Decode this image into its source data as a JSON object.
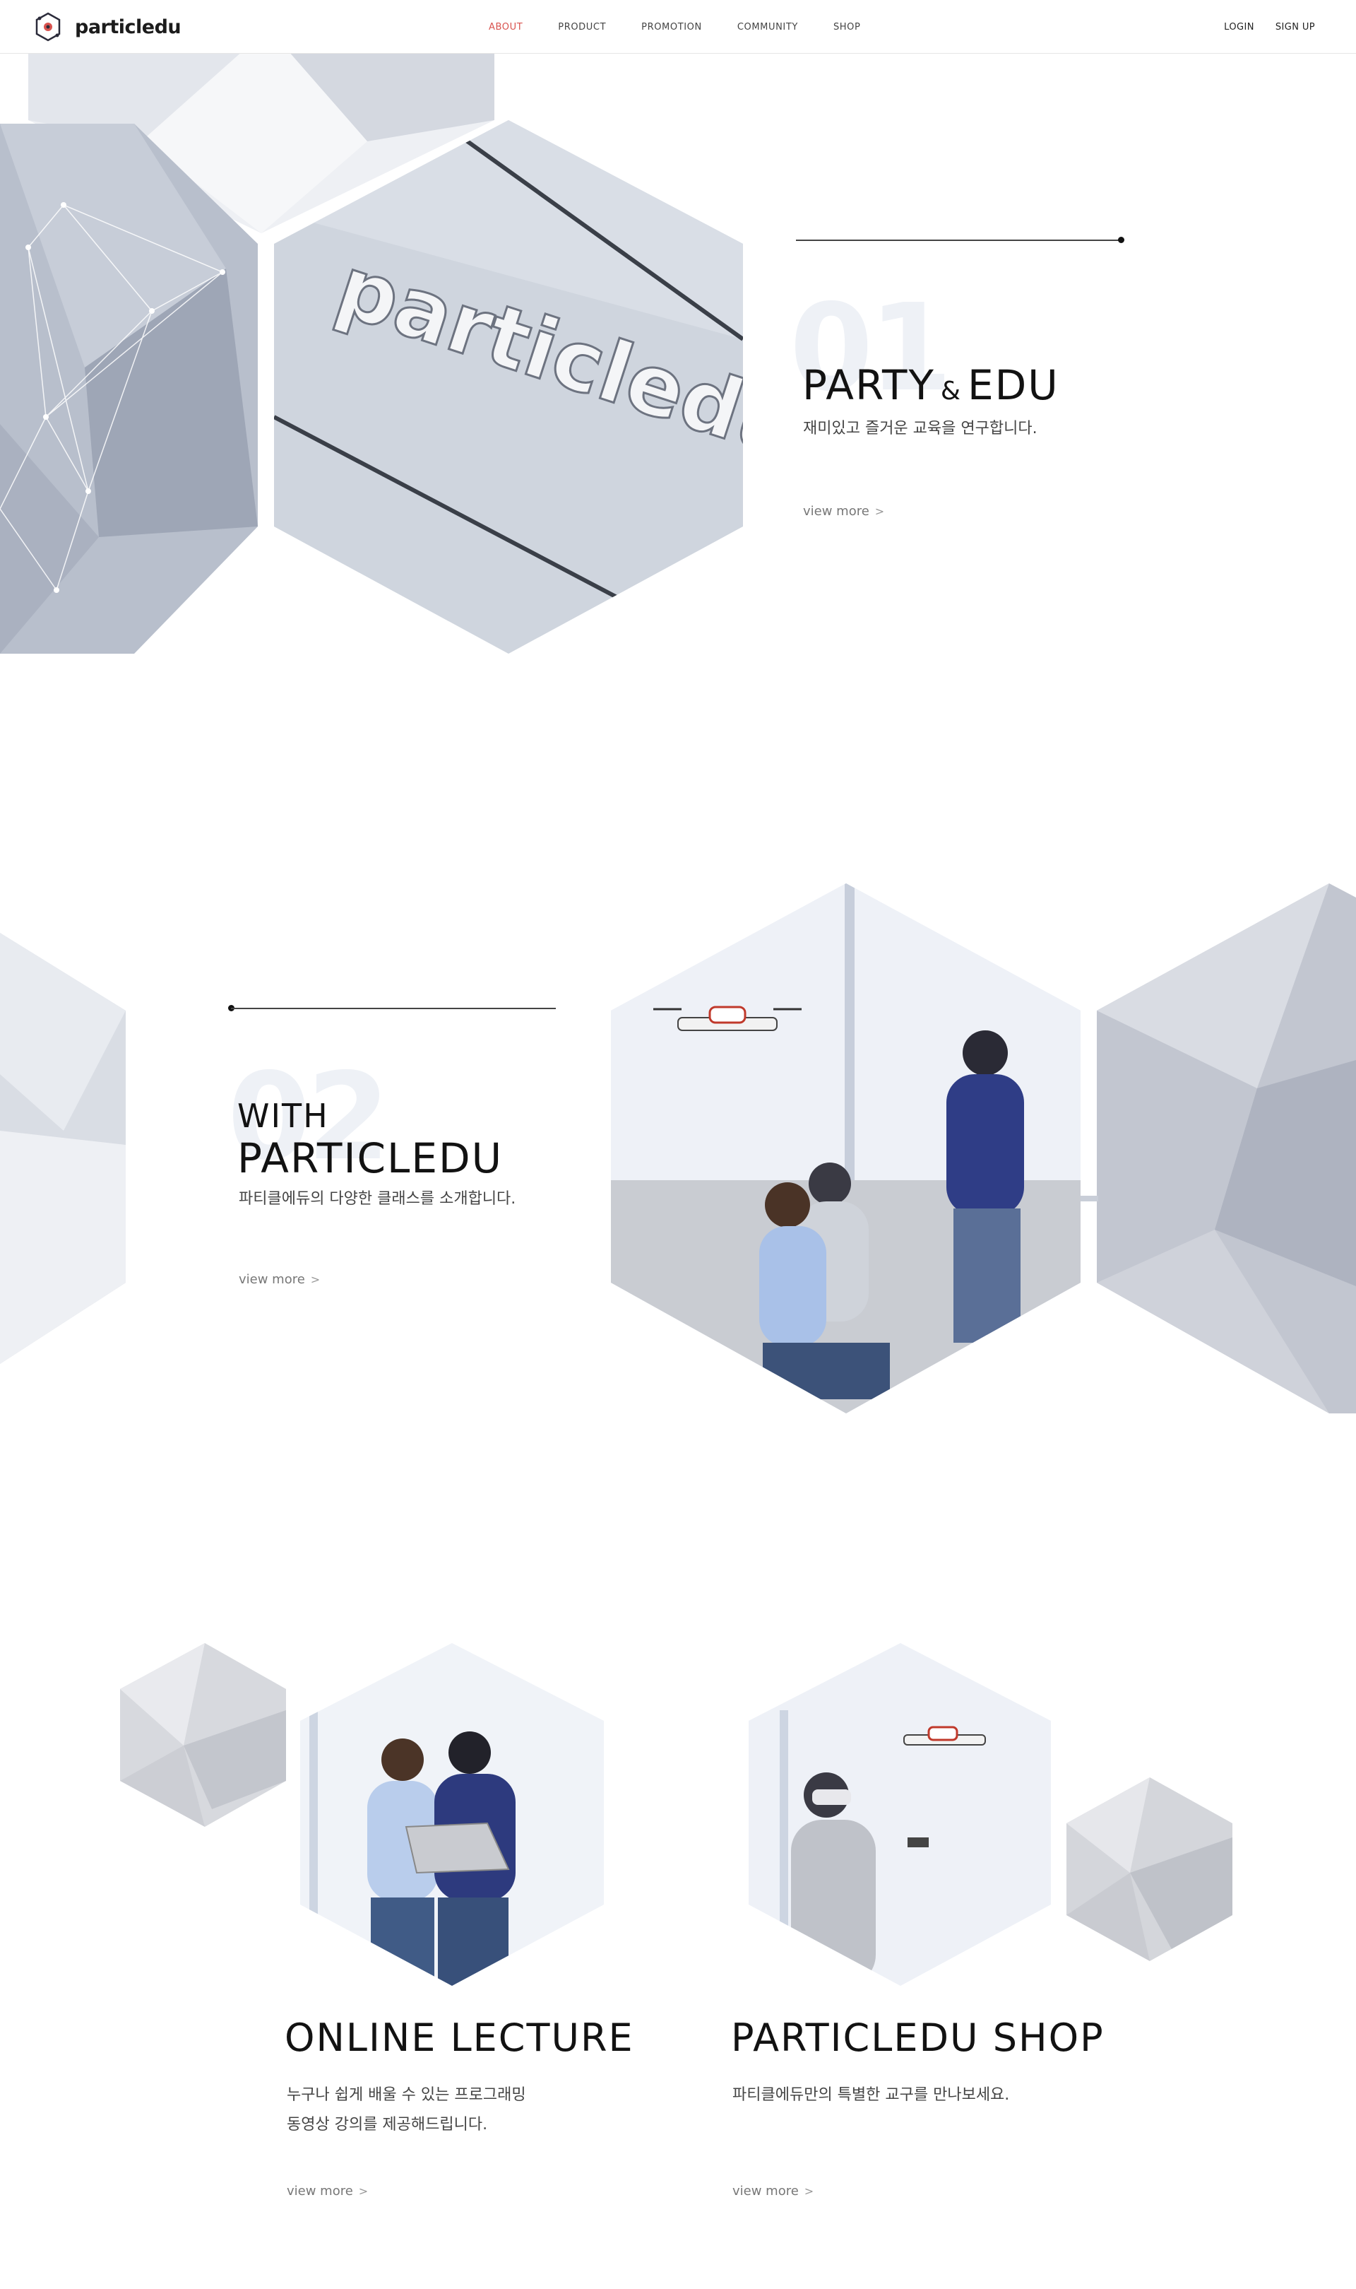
{
  "brand": {
    "name": "particledu",
    "logo_icon": "atom-icon"
  },
  "nav": {
    "items": [
      {
        "label": "ABOUT",
        "active": true
      },
      {
        "label": "PRODUCT",
        "active": false
      },
      {
        "label": "PROMOTION",
        "active": false
      },
      {
        "label": "COMMUNITY",
        "active": false
      },
      {
        "label": "SHOP",
        "active": false
      }
    ],
    "active_color": "#d9534f"
  },
  "auth": {
    "login": "LOGIN",
    "signup": "SIGN UP"
  },
  "section1": {
    "number": "01",
    "title_a": "PARTY",
    "title_amp": "&",
    "title_b": "EDU",
    "description": "재미있고 즐거운 교육을 연구합니다.",
    "view_more": "view more",
    "sign_text": "particledu"
  },
  "section2": {
    "number": "02",
    "title_line1": "WITH",
    "title_line2": "PARTICLEDU",
    "description": "파티클에듀의 다양한 클래스를 소개합니다.",
    "view_more": "view more"
  },
  "section3": {
    "online": {
      "title": "ONLINE LECTURE",
      "description_line1": "누구나 쉽게 배울 수 있는 프로그래밍",
      "description_line2": "동영상 강의를 제공해드립니다.",
      "view_more": "view more"
    },
    "shop": {
      "title": "PARTICLEDU SHOP",
      "description_line1": "파티클에듀만의 특별한 교구를 만나보세요.",
      "view_more": "view more"
    }
  },
  "colors": {
    "hex_gray": "#c9ced8",
    "hex_light": "#e6e9ef",
    "rule": "#444444",
    "big_number": "#eef1f6"
  }
}
